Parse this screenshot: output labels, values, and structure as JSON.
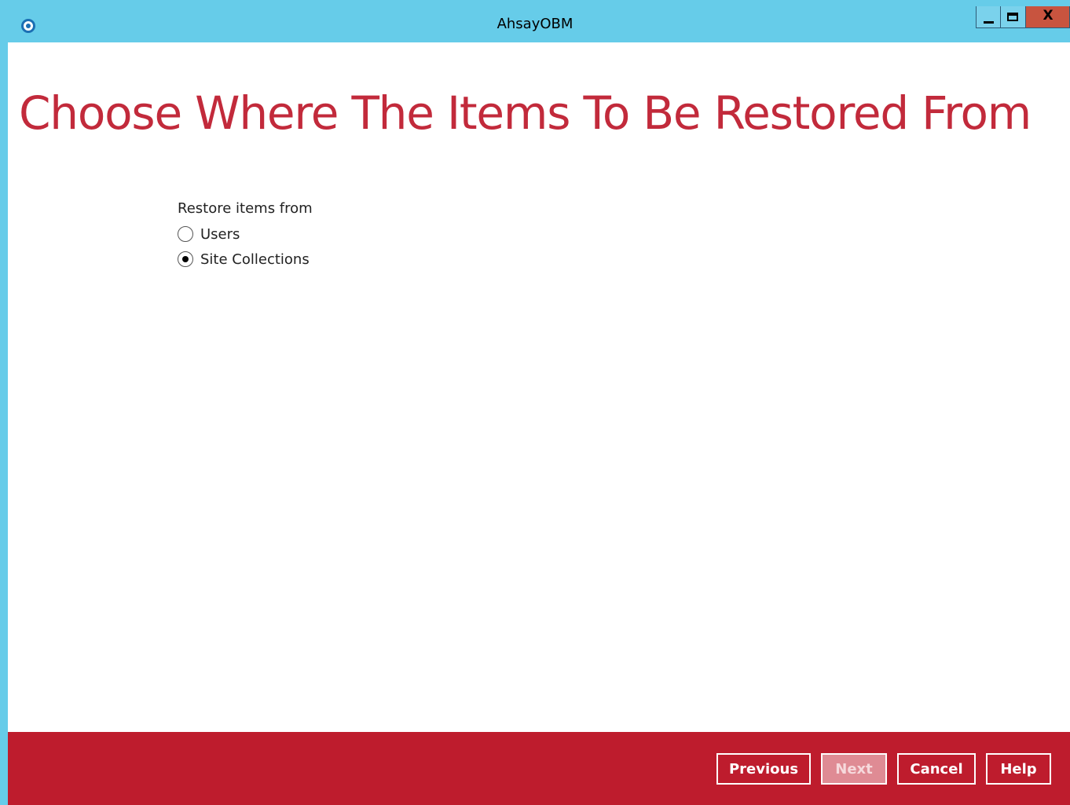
{
  "window": {
    "title": "AhsayOBM",
    "close_glyph": "X",
    "icons": [
      "app-logo-icon",
      "minimize-icon",
      "maximize-icon",
      "close-icon"
    ]
  },
  "page": {
    "title": "Choose Where The Items To Be Restored From"
  },
  "restore_options": {
    "label": "Restore items from",
    "options": [
      {
        "label": "Users",
        "selected": false
      },
      {
        "label": "Site Collections",
        "selected": true
      }
    ]
  },
  "footer": {
    "previous_label": "Previous",
    "next_label": "Next",
    "next_enabled": false,
    "cancel_label": "Cancel",
    "help_label": "Help"
  },
  "colors": {
    "titlebar": "#66cce9",
    "accent_red": "#c22a3b",
    "footer_red": "#be1c2d"
  }
}
